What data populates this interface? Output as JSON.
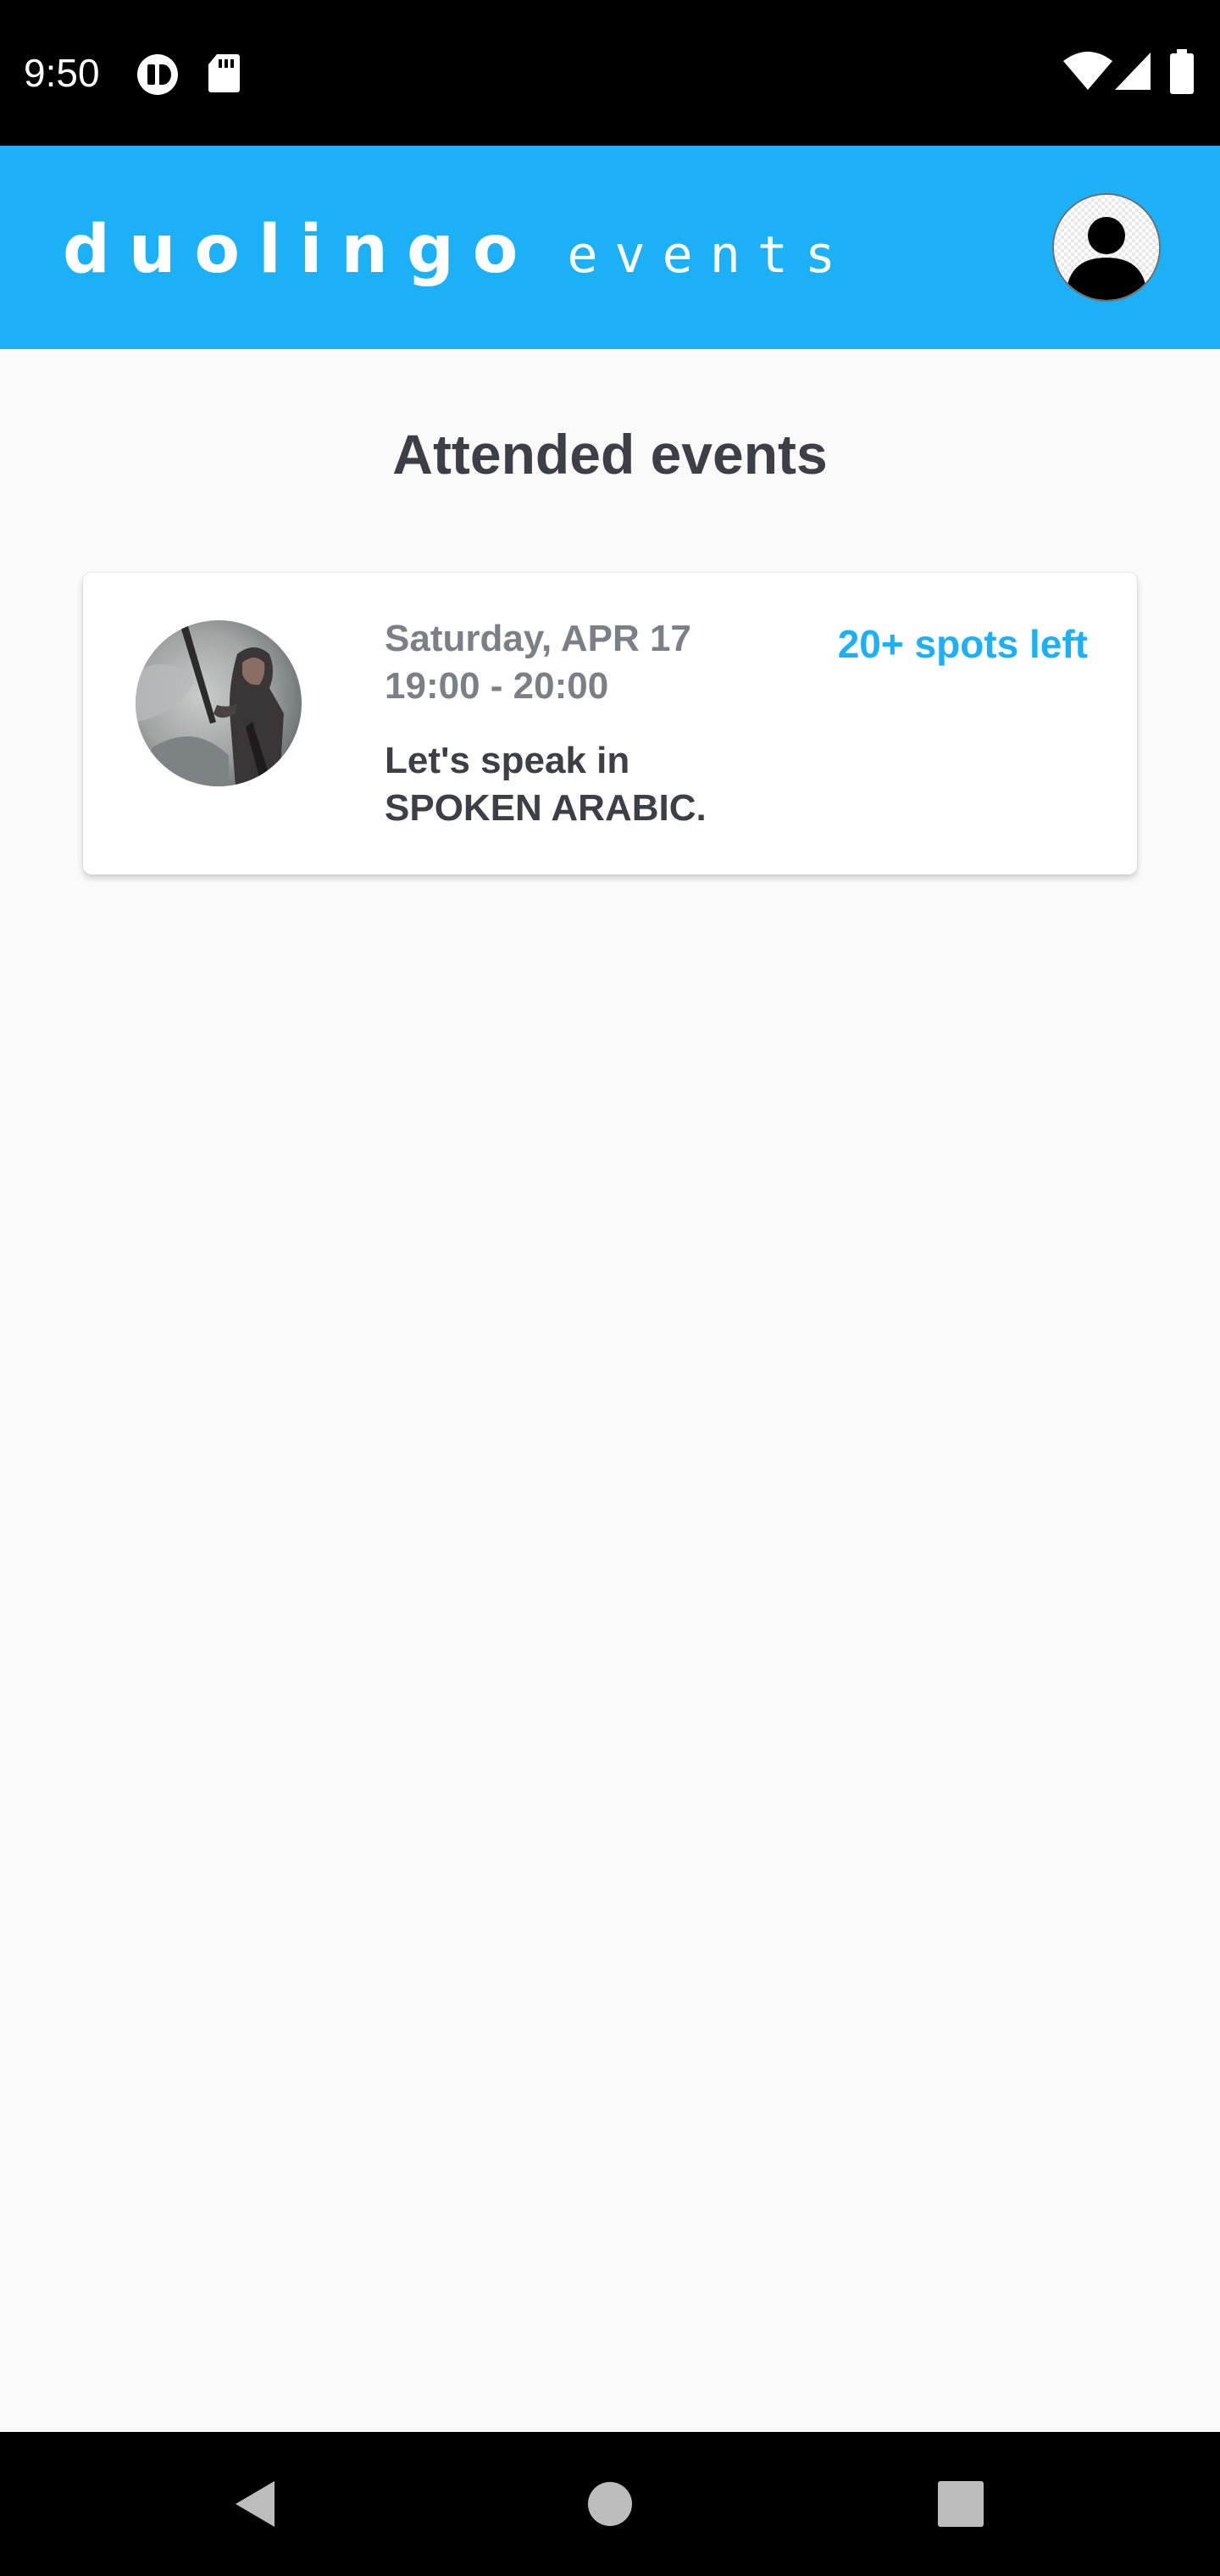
{
  "status_bar": {
    "time": "9:50",
    "icons": [
      "notification-icon",
      "sd-card-icon",
      "wifi-icon",
      "cellular-signal-icon",
      "battery-icon"
    ]
  },
  "header": {
    "brand_name": "duolingo",
    "brand_suffix": "events",
    "brand_color": "#1cb0f6",
    "profile_icon": "user-avatar-icon"
  },
  "page": {
    "title": "Attended events"
  },
  "events": [
    {
      "date": "Saturday, APR 17",
      "time": "19:00 - 20:00",
      "title_line1": "Let's speak in",
      "title_line2": "SPOKEN ARABIC.",
      "spots": "20+ spots left",
      "spots_color": "#1cb0f6"
    }
  ],
  "nav_bar": {
    "icons": [
      "back-icon",
      "home-icon",
      "recents-icon"
    ]
  }
}
